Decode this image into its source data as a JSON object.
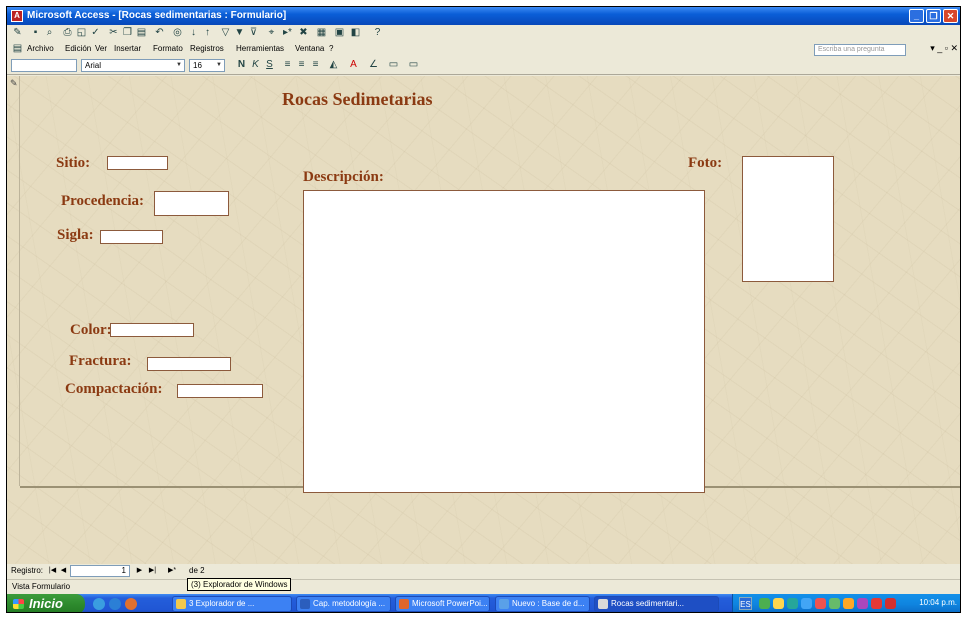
{
  "window": {
    "title": "Microsoft Access - [Rocas sedimentarias : Formulario]"
  },
  "menu": [
    "Archivo",
    "Edición",
    "Ver",
    "Insertar",
    "Formato",
    "Registros",
    "Herramientas",
    "Ventana",
    "?"
  ],
  "help_box": {
    "placeholder": "Escriba una pregunta"
  },
  "format_toolbar": {
    "object_combo": "",
    "font": "Arial",
    "size": "16"
  },
  "form": {
    "title": "Rocas Sedimetarias",
    "labels": {
      "sitio": "Sitio:",
      "procedencia": "Procedencia:",
      "sigla": "Sigla:",
      "color": "Color:",
      "fractura": "Fractura:",
      "compactacion": "Compactación:",
      "descripcion": "Descripción:",
      "foto": "Foto:"
    }
  },
  "navigation": {
    "label": "Registro:",
    "current": "1",
    "of_text": "de 2"
  },
  "status": {
    "text": "Vista Formulario",
    "tooltip": "(3) Explorador de Windows"
  },
  "taskbar": {
    "start": "Inicio",
    "tasks": [
      "3 Explorador de ...",
      "Cap. metodología ...",
      "Microsoft PowerPoi...",
      "Nuevo : Base de d...",
      "Rocas sedimentari..."
    ],
    "lang": "ES",
    "clock": "10:04 p.m."
  },
  "colors": {
    "label_brown": "#8b3a12",
    "form_bg": "#e6dcc0",
    "taskbar_blue": "#245edb",
    "start_green": "#2e8b2e"
  }
}
